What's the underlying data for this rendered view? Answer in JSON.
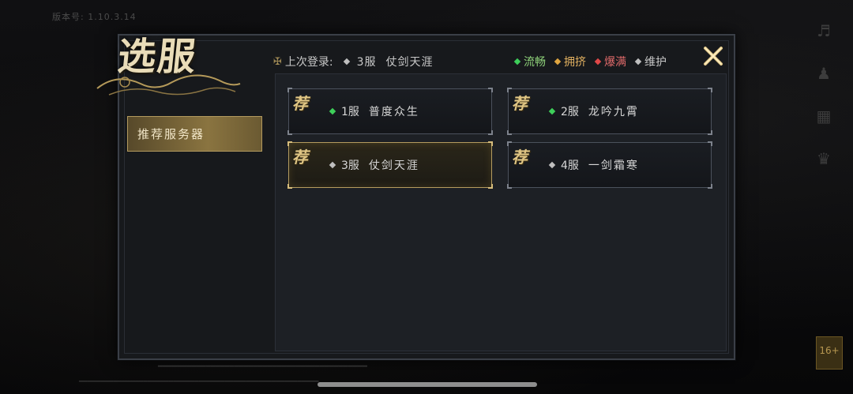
{
  "version_text": "版本号: 1.10.3.14",
  "title": "选服",
  "sidebar": {
    "tab_label": "推荐服务器"
  },
  "last_login": {
    "label": "上次登录:",
    "server_num": "3服",
    "server_name": "仗剑天涯",
    "status_color": "#bfbfbf"
  },
  "legend": [
    {
      "label": "流畅",
      "color": "#3ecf5a",
      "text_color": "#8fd27a"
    },
    {
      "label": "拥挤",
      "color": "#e0a640",
      "text_color": "#e0b060"
    },
    {
      "label": "爆满",
      "color": "#e04848",
      "text_color": "#e06a6a"
    },
    {
      "label": "维护",
      "color": "#bfbfbf",
      "text_color": "#c8c8c8"
    }
  ],
  "recommend_tag": "荐",
  "servers": [
    {
      "num": "1服",
      "name": "普度众生",
      "status_color": "#3ecf5a",
      "selected": false
    },
    {
      "num": "2服",
      "name": "龙吟九霄",
      "status_color": "#3ecf5a",
      "selected": false
    },
    {
      "num": "3服",
      "name": "仗剑天涯",
      "status_color": "#bfbfbf",
      "selected": true
    },
    {
      "num": "4服",
      "name": "一剑霜寒",
      "status_color": "#bfbfbf",
      "selected": false
    }
  ],
  "age_rating": "16+",
  "side_icons": [
    "speaker-icon",
    "user-icon",
    "notice-icon",
    "service-icon"
  ]
}
